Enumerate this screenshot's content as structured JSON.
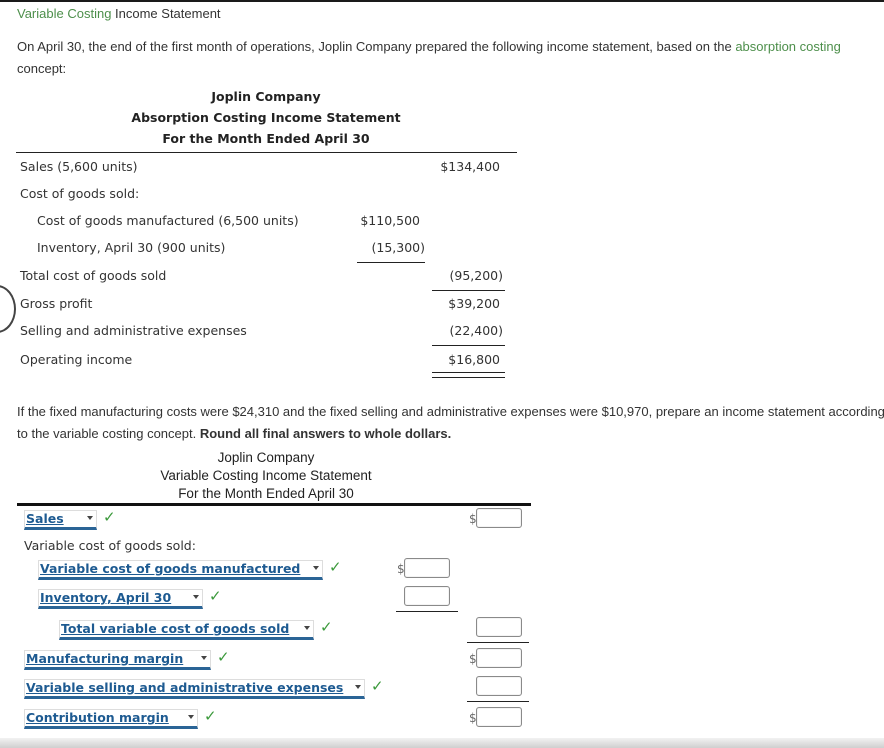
{
  "page": {
    "title_link": "Variable Costing",
    "title_rest": " Income Statement",
    "intro_text": "On April 30, the end of the first month of operations, Joplin Company prepared the following income statement, based on the ",
    "intro_link": "absorption costing",
    "intro_end": " concept:"
  },
  "absorption": {
    "company": "Joplin Company",
    "statement": "Absorption Costing Income Statement",
    "period": "For the Month Ended April 30",
    "rows": [
      {
        "label": "Sales (5,600 units)",
        "col1": "",
        "col2": "$134,400"
      },
      {
        "label": "Cost of goods sold:",
        "col1": "",
        "col2": ""
      },
      {
        "label": "Cost of goods manufactured (6,500 units)",
        "col1": "$110,500",
        "col2": ""
      },
      {
        "label": "Inventory, April 30 (900 units)",
        "col1": "(15,300)",
        "col2": ""
      },
      {
        "label": "Total cost of goods sold",
        "col1": "",
        "col2": "(95,200)"
      },
      {
        "label": "Gross profit",
        "col1": "",
        "col2": "$39,200"
      },
      {
        "label": "Selling and administrative expenses",
        "col1": "",
        "col2": "(22,400)"
      },
      {
        "label": "Operating income",
        "col1": "",
        "col2": "$16,800"
      }
    ]
  },
  "question": {
    "text": "If the fixed manufacturing costs were $24,310 and the fixed selling and administrative expenses were $10,970, prepare an income statement according to the variable costing concept. ",
    "bold": "Round all final answers to whole dollars."
  },
  "variable": {
    "company": "Joplin Company",
    "statement": "Variable Costing Income Statement",
    "period": "For the Month Ended April 30",
    "static_label": "Variable cost of goods sold:",
    "currency_symbol": "$",
    "check_glyph": "✓",
    "selects": [
      {
        "selected": "Sales",
        "status": "correct",
        "value": ""
      },
      {
        "selected": "Variable cost of goods manufactured",
        "status": "correct",
        "value": ""
      },
      {
        "selected": "Inventory, April 30",
        "status": "correct",
        "value": ""
      },
      {
        "selected": "Total variable cost of goods sold",
        "status": "correct",
        "value": ""
      },
      {
        "selected": "Manufacturing margin",
        "status": "correct",
        "value": ""
      },
      {
        "selected": "Variable selling and administrative expenses",
        "status": "correct",
        "value": ""
      },
      {
        "selected": "Contribution margin",
        "status": "correct",
        "value": ""
      }
    ]
  },
  "colors": {
    "link_green": "#4d8f4b",
    "select_blue": "#1d5a91",
    "check_green": "#3c9a3c"
  }
}
